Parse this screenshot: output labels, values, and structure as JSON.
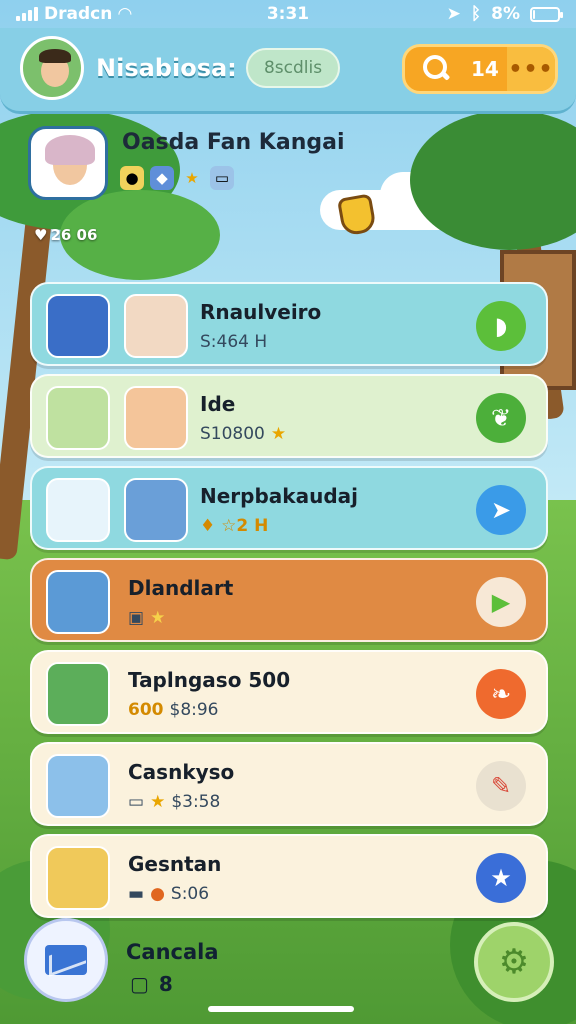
{
  "status_bar": {
    "carrier": "Dradcn",
    "time": "3:31",
    "battery": "8%",
    "battery_level": 0.08
  },
  "header": {
    "title": "Nisabiosa:",
    "pill_label": "8scdlis",
    "search_count": "14",
    "more_label": "•••"
  },
  "profile": {
    "name": "Oasda Fan Kangai",
    "likes": "26 06"
  },
  "items": [
    {
      "title": "Rnaulveiro",
      "subtitle": "S:464 H",
      "action": "chat-icon",
      "color": "#8fd9e0"
    },
    {
      "title": "Ide",
      "subtitle": "S10800",
      "action": "leaf-icon",
      "color": "#dff1cf"
    },
    {
      "title": "Nerpbakaudaj",
      "subtitle": "♦ ☆2 H",
      "action": "send-icon",
      "color": "#8fd9e0"
    },
    {
      "title": "Dlandlart",
      "subtitle": "",
      "action": "play-icon",
      "color": "#e08a43"
    },
    {
      "title": "Taplngaso 500",
      "subtitle_prefix": "600",
      "subtitle": "$8:96",
      "action": "leaf-orange-icon",
      "color": "#fbf2dd"
    },
    {
      "title": "Casnkyso",
      "subtitle": "$3:58",
      "action": "pencil-icon",
      "color": "#fbf2dd"
    },
    {
      "title": "Gesntan",
      "subtitle": "S:06",
      "action": "star-icon",
      "color": "#fbf2dd"
    }
  ],
  "bottom": {
    "title": "Cancala",
    "count": "8"
  }
}
